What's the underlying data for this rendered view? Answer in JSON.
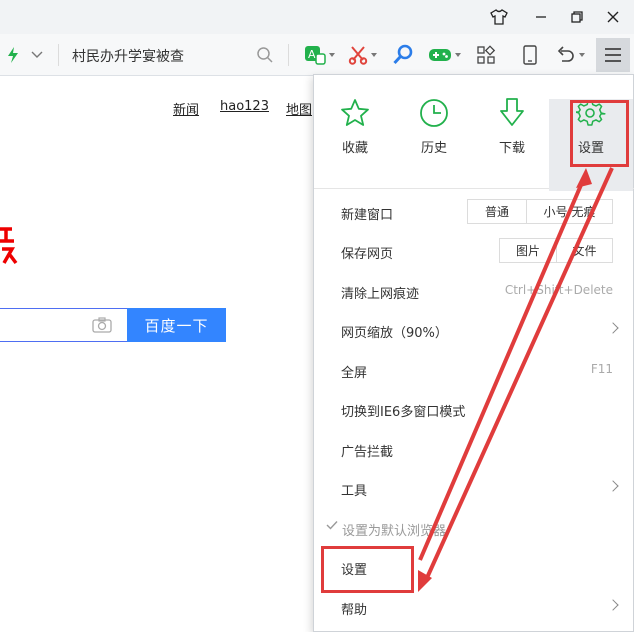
{
  "address_bar": {
    "text": "村民办升学宴被查"
  },
  "page": {
    "nav_links": [
      "新闻",
      "hao123",
      "地图"
    ],
    "search_button_label": "百度一下"
  },
  "menu": {
    "quick_items": [
      {
        "label": "收藏",
        "icon": "star-icon"
      },
      {
        "label": "历史",
        "icon": "clock-icon"
      },
      {
        "label": "下载",
        "icon": "download-icon"
      },
      {
        "label": "设置",
        "icon": "gear-icon"
      }
    ],
    "new_window": {
      "label": "新建窗口",
      "options": [
        "普通",
        "小号/无痕"
      ]
    },
    "save_page": {
      "label": "保存网页",
      "options": [
        "图片",
        "文件"
      ]
    },
    "clear_traces": {
      "label": "清除上网痕迹",
      "shortcut": "Ctrl+Shift+Delete"
    },
    "zoom": {
      "label": "网页缩放（90%）"
    },
    "fullscreen": {
      "label": "全屏",
      "shortcut": "F11"
    },
    "ie6_mode": {
      "label": "切换到IE6多窗口模式"
    },
    "adblock": {
      "label": "广告拦截"
    },
    "tools": {
      "label": "工具"
    },
    "default_browser": {
      "label": "设置为默认浏览器"
    },
    "settings": {
      "label": "设置"
    },
    "help": {
      "label": "帮助"
    }
  },
  "colors": {
    "accent_green": "#22b14c",
    "annotation_red": "#e03c3c",
    "search_blue": "#3385ff"
  }
}
